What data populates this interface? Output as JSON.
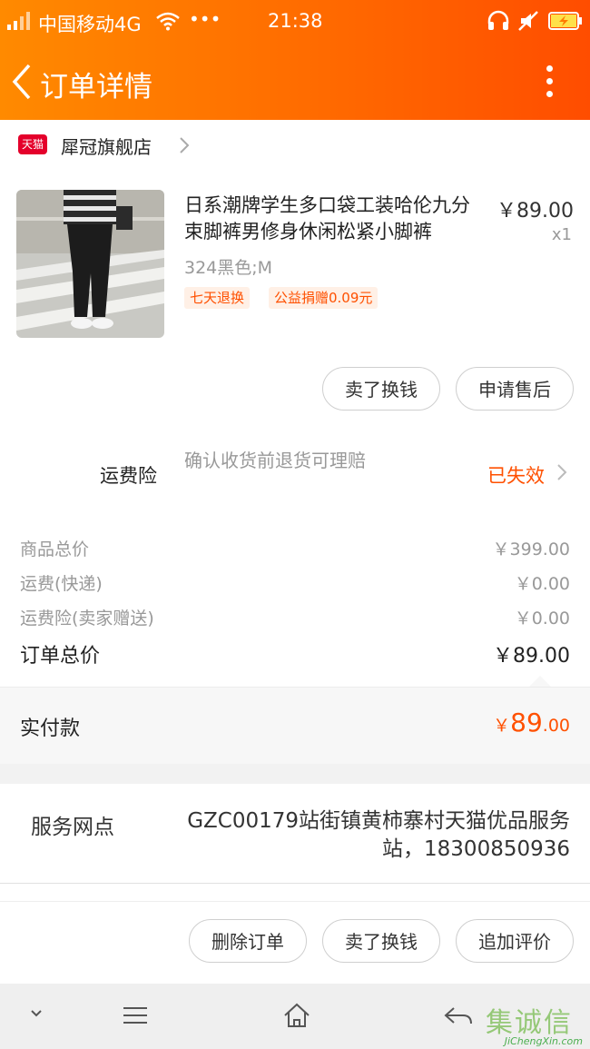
{
  "status_bar": {
    "carrier": "中国移动4G",
    "dots": "•••",
    "time": "21:38"
  },
  "nav": {
    "title": "订单详情"
  },
  "store": {
    "badge": "天猫",
    "name": "犀冠旗舰店"
  },
  "product": {
    "title": "日系潮牌学生多口袋工装哈伦九分束脚裤男修身休闲松紧小脚裤",
    "price": "￥89.00",
    "quantity": "x1",
    "sku": "324黑色;M",
    "tags": [
      "七天退换",
      "公益捐赠0.09元"
    ]
  },
  "item_actions": {
    "sell_label": "卖了换钱",
    "after_sales_label": "申请售后"
  },
  "insurance": {
    "label": "运费险",
    "description": "确认收货前退货可理赔",
    "status": "已失效"
  },
  "summary": {
    "rows": [
      {
        "label": "商品总价",
        "value": "￥399.00"
      },
      {
        "label": "运费(快递)",
        "value": "￥0.00"
      },
      {
        "label": "运费险(卖家赠送)",
        "value": "￥0.00"
      }
    ],
    "total_label": "订单总价",
    "total_value": "￥89.00"
  },
  "payment": {
    "label": "实付款",
    "symbol": "￥",
    "integer": "89",
    "decimal": ".00"
  },
  "service": {
    "label": "服务网点",
    "value": "GZC00179站街镇黄柿寨村天猫优品服务站，18300850936"
  },
  "bottom_actions": {
    "delete_label": "删除订单",
    "sell_label": "卖了换钱",
    "review_label": "追加评价"
  },
  "watermark": {
    "brand": "集诚信",
    "url": "JiChengXin.com"
  },
  "colors": {
    "accent": "#ff5000",
    "header_gradient_start": "#ff8a00",
    "header_gradient_end": "#ff4d00"
  }
}
